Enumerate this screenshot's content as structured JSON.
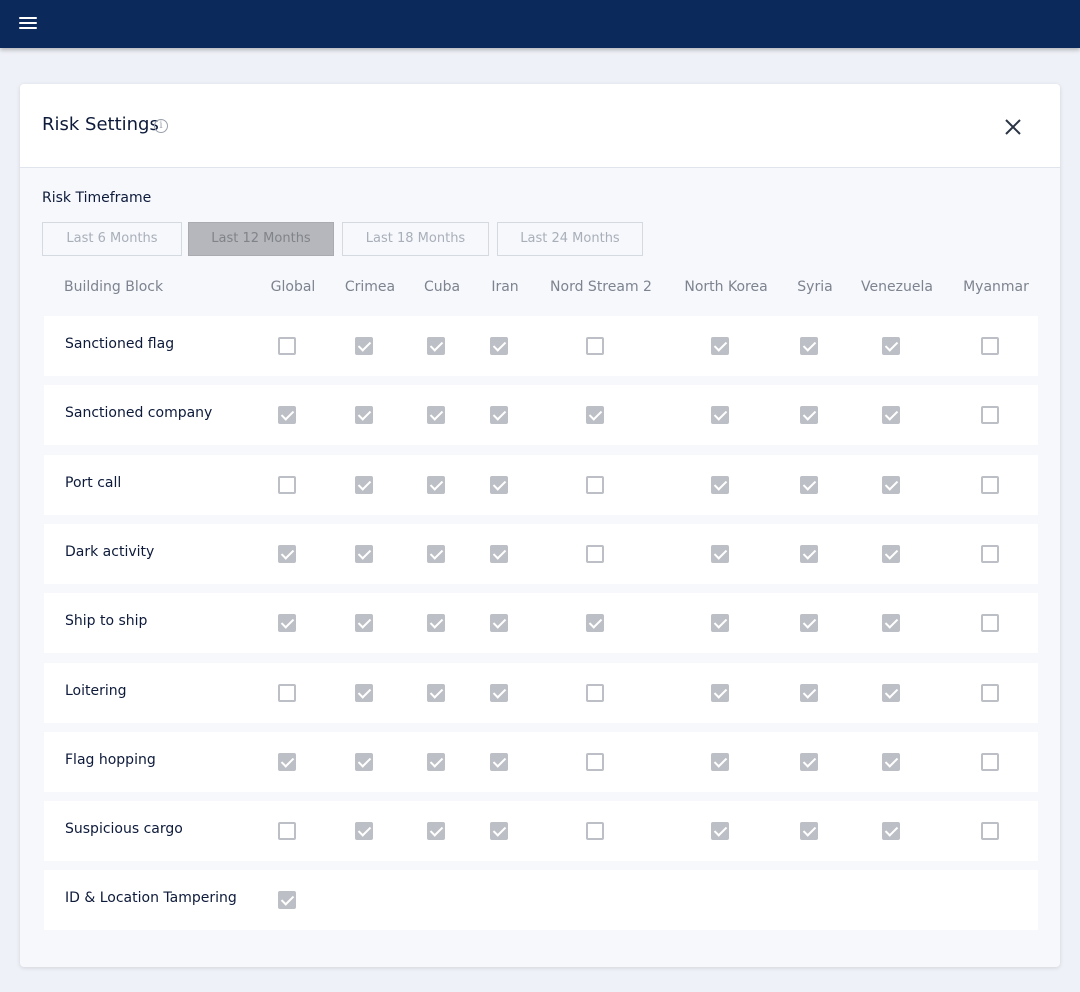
{
  "header": {
    "menu_icon": "hamburger-menu-icon"
  },
  "panel": {
    "title": "Risk Settings",
    "info_icon_glyph": "i",
    "close_icon": "close-icon"
  },
  "timeframe": {
    "label": "Risk Timeframe",
    "options": [
      "Last 6 Months",
      "Last 12 Months",
      "Last 18 Months",
      "Last 24 Months"
    ],
    "selected": "Last 12 Months"
  },
  "table": {
    "columns": [
      "Building Block",
      "Global",
      "Crimea",
      "Cuba",
      "Iran",
      "Nord Stream 2",
      "North Korea",
      "Syria",
      "Venezuela",
      "Myanmar"
    ],
    "rows": [
      {
        "label": "Sanctioned flag",
        "values": [
          false,
          true,
          true,
          true,
          false,
          true,
          true,
          true,
          false
        ]
      },
      {
        "label": "Sanctioned company",
        "values": [
          true,
          true,
          true,
          true,
          true,
          true,
          true,
          true,
          false
        ]
      },
      {
        "label": "Port call",
        "values": [
          false,
          true,
          true,
          true,
          false,
          true,
          true,
          true,
          false
        ]
      },
      {
        "label": "Dark activity",
        "values": [
          true,
          true,
          true,
          true,
          false,
          true,
          true,
          true,
          false
        ]
      },
      {
        "label": "Ship to ship",
        "values": [
          true,
          true,
          true,
          true,
          true,
          true,
          true,
          true,
          false
        ]
      },
      {
        "label": "Loitering",
        "values": [
          false,
          true,
          true,
          true,
          false,
          true,
          true,
          true,
          false
        ]
      },
      {
        "label": "Flag hopping",
        "values": [
          true,
          true,
          true,
          true,
          false,
          true,
          true,
          true,
          false
        ]
      },
      {
        "label": "Suspicious cargo",
        "values": [
          false,
          true,
          true,
          true,
          false,
          true,
          true,
          true,
          false
        ]
      },
      {
        "label": "ID & Location Tampering",
        "values": [
          true
        ]
      }
    ]
  },
  "colors": {
    "topbar": "#0b2a5b",
    "checkbox": "#bcbfc5",
    "active_button": "#b5b7bc"
  }
}
